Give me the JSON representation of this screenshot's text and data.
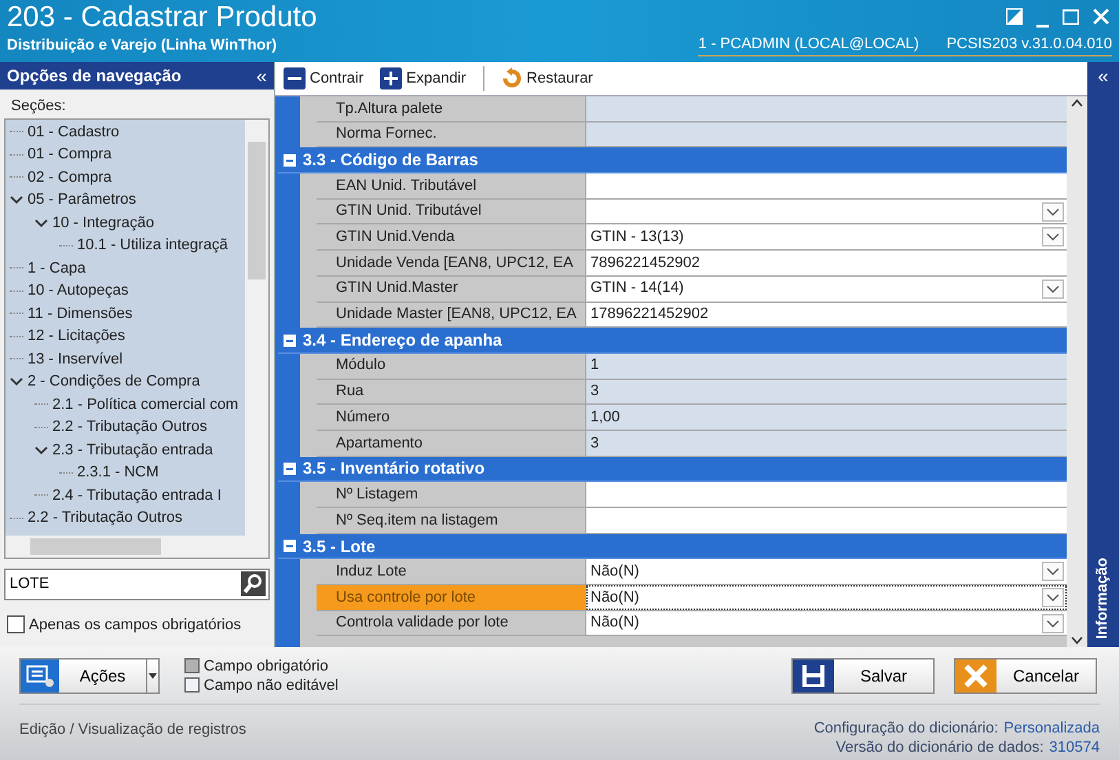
{
  "window": {
    "title": "203 - Cadastrar  Produto",
    "subtitle": "Distribuição e Varejo (Linha WinThor)",
    "user": "1 - PCADMIN (LOCAL@LOCAL)",
    "version": "PCSIS203  v.31.0.04.010"
  },
  "nav": {
    "title": "Opções de navegação",
    "collapse": "«",
    "sections_label": "Seções:",
    "tree": [
      {
        "label": "01 - Cadastro"
      },
      {
        "label": "01 - Compra"
      },
      {
        "label": "02 - Compra"
      },
      {
        "label": "05 - Parâmetros",
        "expanded": true,
        "children": [
          {
            "label": "10 - Integração",
            "expanded": true,
            "children": [
              {
                "label": "10.1 - Utiliza integraçã"
              }
            ]
          }
        ]
      },
      {
        "label": "1 - Capa"
      },
      {
        "label": "10 - Autopeças"
      },
      {
        "label": "11 - Dimensões"
      },
      {
        "label": "12 - Licitações"
      },
      {
        "label": "13 - Inservível"
      },
      {
        "label": "2 - Condições de Compra",
        "expanded": true,
        "children": [
          {
            "label": "2.1 - Política comercial com"
          },
          {
            "label": "2.2 - Tributação Outros"
          },
          {
            "label": "2.3 - Tributação entrada",
            "expanded": true,
            "children": [
              {
                "label": "2.3.1 - NCM"
              }
            ]
          },
          {
            "label": "2.4 - Tributação entrada I"
          }
        ]
      },
      {
        "label": "2.2 - Tributação Outros"
      }
    ],
    "search": {
      "value": "LOTE"
    },
    "required_only": {
      "label": "Apenas os campos obrigatórios",
      "checked": false
    }
  },
  "toolbar": [
    {
      "label": "Contrair",
      "kind": "collapse"
    },
    {
      "label": "Expandir",
      "kind": "expand"
    },
    {
      "label": "Restaurar",
      "kind": "restore"
    }
  ],
  "side_panel": {
    "collapse": "«",
    "label": "Informação"
  },
  "grid": [
    {
      "rows": [
        {
          "label": "Tp.Altura palete",
          "kind": "text",
          "editable": false,
          "selected": false
        },
        {
          "label": "Norma Fornec.",
          "kind": "text",
          "editable": false,
          "selected": false
        }
      ]
    },
    {
      "title": "3.3 - Código de Barras",
      "rows": [
        {
          "label": "EAN Unid. Tributável",
          "kind": "text",
          "editable": true,
          "selected": false
        },
        {
          "label": "GTIN Unid. Tributável",
          "kind": "combo",
          "editable": true,
          "selected": false
        },
        {
          "label": "GTIN Unid.Venda",
          "value": "GTIN - 13(13)",
          "kind": "combo",
          "editable": true,
          "selected": false
        },
        {
          "label": "Unidade Venda [EAN8, UPC12, EA",
          "value": "7896221452902",
          "kind": "text",
          "editable": true,
          "selected": false
        },
        {
          "label": "GTIN Unid.Master",
          "value": "GTIN - 14(14)",
          "kind": "combo",
          "editable": true,
          "selected": false
        },
        {
          "label": "Unidade Master [EAN8, UPC12, EA",
          "value": "17896221452902",
          "kind": "text",
          "editable": true,
          "selected": false
        }
      ]
    },
    {
      "title": "3.4 - Endereço de apanha",
      "rows": [
        {
          "label": "Módulo",
          "value": "1",
          "kind": "text",
          "editable": false,
          "selected": false
        },
        {
          "label": "Rua",
          "value": "3",
          "kind": "text",
          "editable": false,
          "selected": false
        },
        {
          "label": "Número",
          "value": "1,00",
          "kind": "text",
          "editable": false,
          "selected": false
        },
        {
          "label": "Apartamento",
          "value": "3",
          "kind": "text",
          "editable": false,
          "selected": false
        }
      ]
    },
    {
      "title": "3.5 - Inventário rotativo",
      "rows": [
        {
          "label": "Nº Listagem",
          "kind": "text",
          "editable": true,
          "selected": false
        },
        {
          "label": "Nº Seq.item na listagem",
          "kind": "text",
          "editable": true,
          "selected": false
        }
      ]
    },
    {
      "title": "3.5 - Lote",
      "rows": [
        {
          "label": "Induz Lote",
          "value": "Não(N)",
          "kind": "combo",
          "editable": true,
          "selected": false
        },
        {
          "label": "Usa controle por lote",
          "value": "Não(N)",
          "kind": "combo",
          "editable": true,
          "selected": true
        },
        {
          "label": "Controla validade por lote",
          "value": "Não(N)",
          "kind": "combo",
          "editable": true,
          "selected": false
        }
      ]
    }
  ],
  "actions_button": "Ações",
  "legend": [
    {
      "label": "Campo obrigatório",
      "kind": "required"
    },
    {
      "label": "Campo não editável",
      "kind": "readonly"
    }
  ],
  "buttons": [
    {
      "label": "Salvar",
      "kind": "save"
    },
    {
      "label": "Cancelar",
      "kind": "cancel"
    }
  ],
  "status": {
    "mode": "Edição / Visualização de registros",
    "config_label": "Configuração do dicionário:",
    "config_value": "Personalizada",
    "version_label": "Versão do dicionário de dados:",
    "version_value": "310574"
  }
}
